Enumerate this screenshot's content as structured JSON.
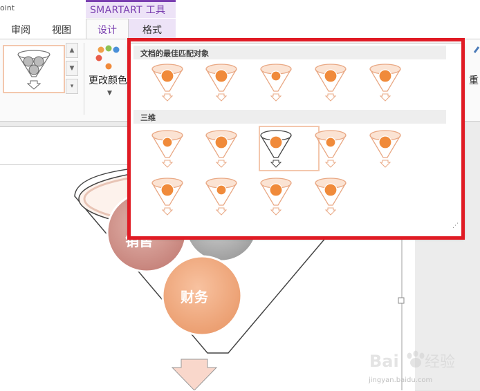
{
  "app": {
    "title_fragment": "oint"
  },
  "ribbon": {
    "context_tab_group": "SMARTART 工具",
    "tabs": [
      {
        "label": "审阅"
      },
      {
        "label": "视图"
      },
      {
        "label": "设计"
      },
      {
        "label": "格式"
      }
    ],
    "change_color_label": "更改颜色",
    "reset_label": "重"
  },
  "gallery": {
    "sections": [
      {
        "title": "文档的最佳匹配对象",
        "item_count": 5
      },
      {
        "title": "三维",
        "item_count": 9
      }
    ],
    "selected_section": 1,
    "selected_index": 2
  },
  "slide": {
    "shape_labels": [
      "财务",
      "销售"
    ]
  },
  "watermark": {
    "logo_text": "Baidu经验",
    "url_text": "jingyan.baidu.com"
  },
  "colors": {
    "accent_orange": "#f08a3a",
    "context_purple": "#7a3fb0",
    "highlight_red": "#e01b24",
    "selection_peach": "#f3c7ad"
  }
}
